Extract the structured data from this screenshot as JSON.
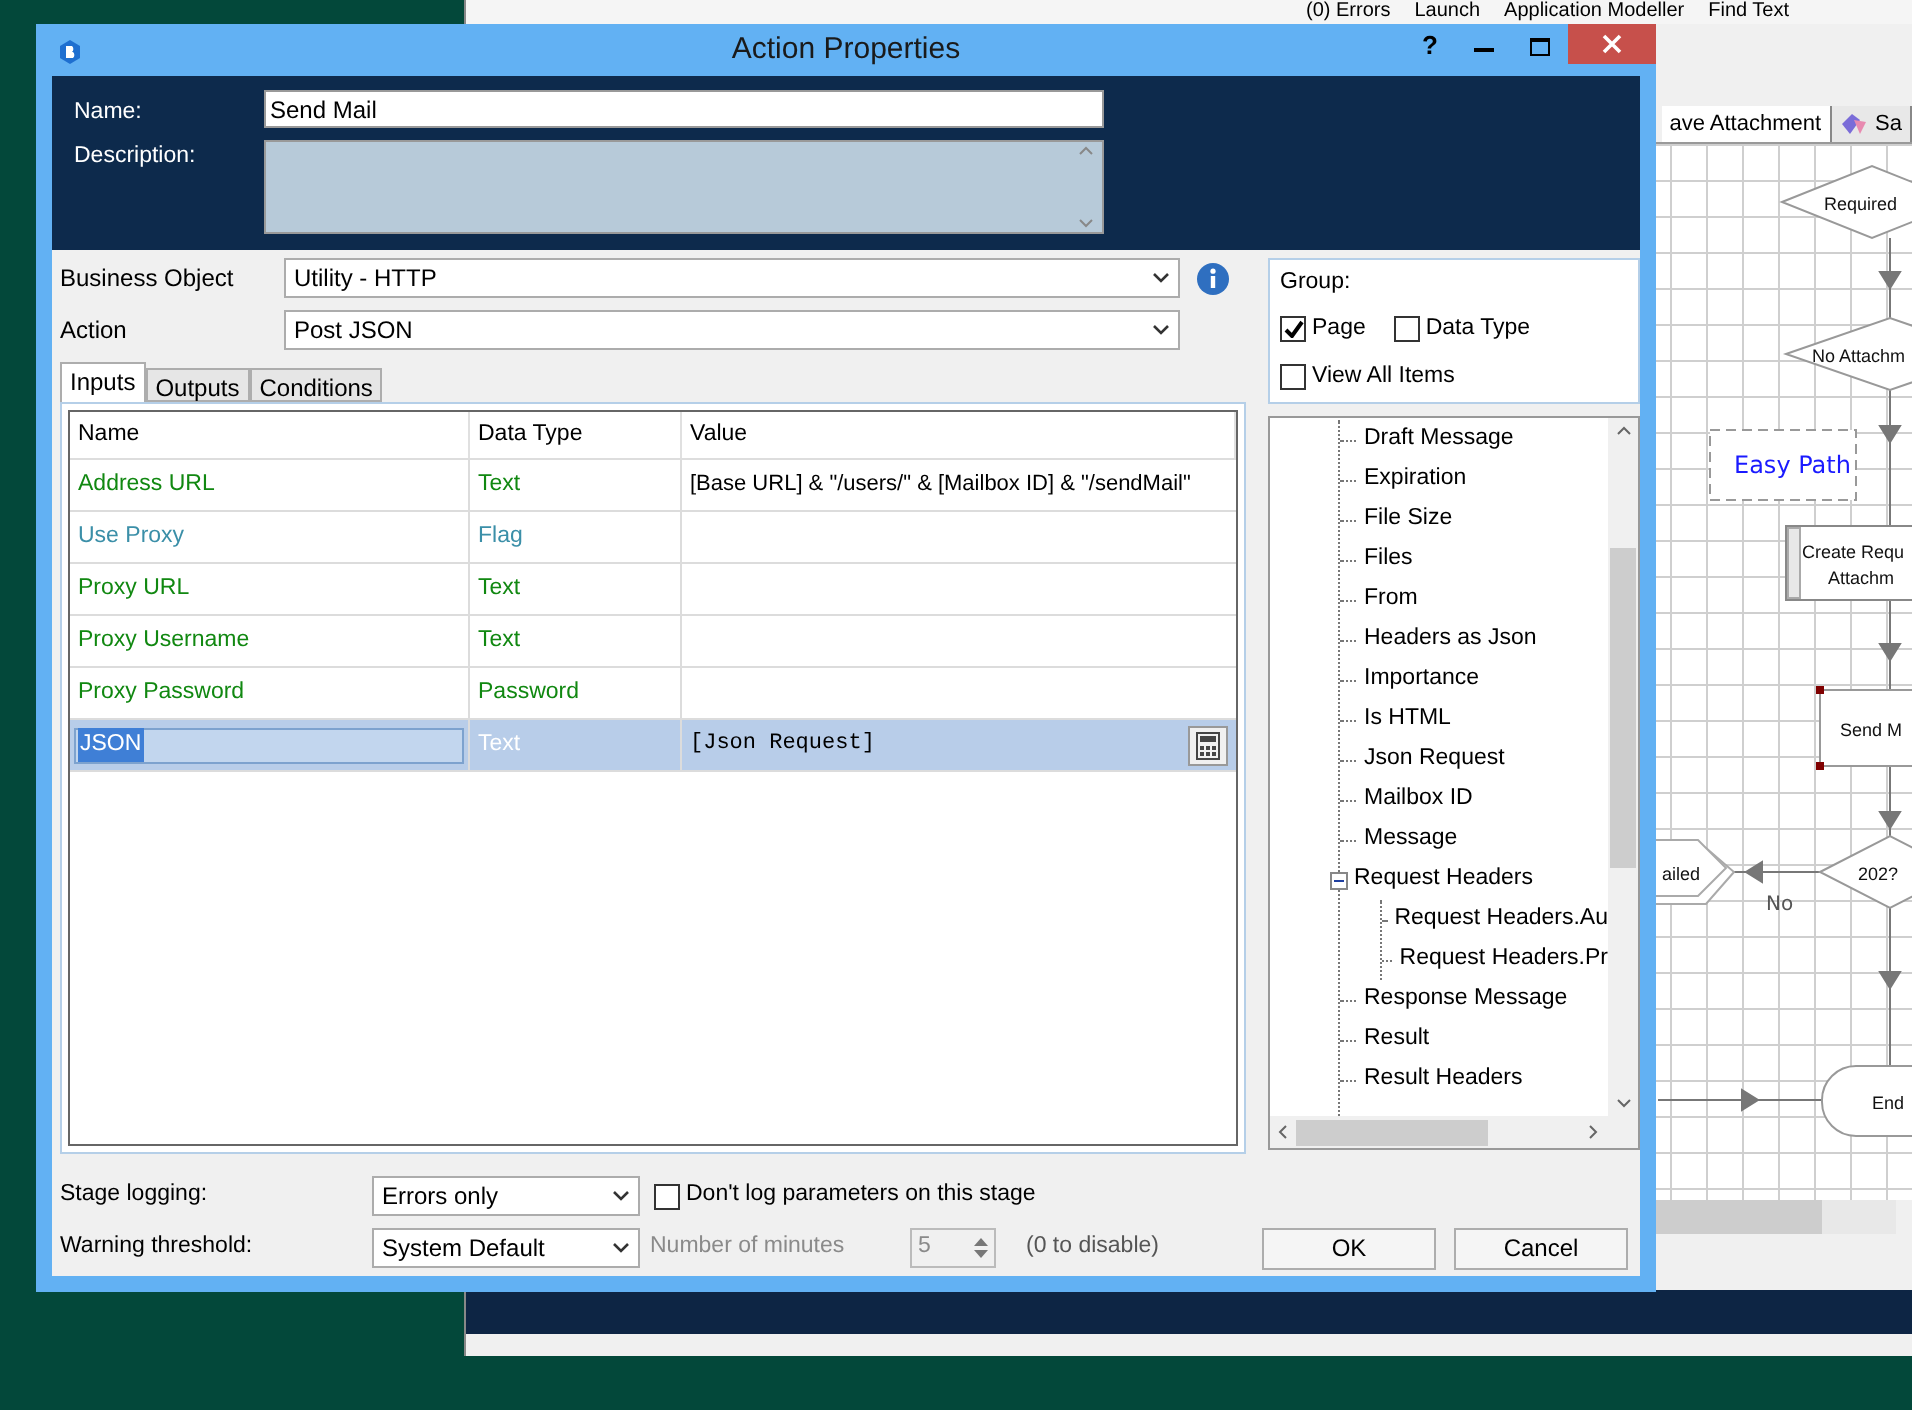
{
  "background_app": {
    "toolbar": [
      {
        "label": "(0) Errors"
      },
      {
        "label": "Launch"
      },
      {
        "label": "Application Modeller"
      },
      {
        "label": "Find Text"
      }
    ],
    "tabs": [
      {
        "label": "ave Attachment",
        "selected": true
      },
      {
        "label": "Sa",
        "selected": false
      }
    ],
    "flowchart": {
      "nodes": [
        {
          "kind": "decision",
          "lines": [
            "Required"
          ]
        },
        {
          "kind": "decision",
          "lines": [
            "No Attachm"
          ]
        },
        {
          "kind": "note",
          "lines": [
            "Easy Path"
          ]
        },
        {
          "kind": "process",
          "lines": [
            "Create Requ",
            "Attachm"
          ]
        },
        {
          "kind": "action",
          "lines": [
            "Send M"
          ],
          "selected": true
        },
        {
          "kind": "decision",
          "lines": [
            "202?"
          ]
        },
        {
          "kind": "exception",
          "lines": [
            "ailed"
          ]
        },
        {
          "kind": "end",
          "lines": [
            "End"
          ]
        }
      ],
      "edge_labels": [
        "No"
      ]
    }
  },
  "dialog": {
    "title": "Action Properties",
    "help": "?",
    "name": {
      "label": "Name:",
      "value": "Send Mail"
    },
    "description": {
      "label": "Description:"
    },
    "business_object": {
      "label": "Business Object",
      "value": "Utility - HTTP"
    },
    "action": {
      "label": "Action",
      "value": "Post JSON"
    },
    "tabs": [
      {
        "label": "Inputs",
        "selected": true
      },
      {
        "label": "Outputs",
        "selected": false
      },
      {
        "label": "Conditions",
        "selected": false
      }
    ],
    "table": {
      "columns": [
        "Name",
        "Data Type",
        "Value"
      ],
      "rows": [
        {
          "name": "Address URL",
          "data_type": "Text",
          "value": "[Base URL] & \"/users/\" & [Mailbox ID] & \"/sendMail\"",
          "color": "#118811",
          "selected": false
        },
        {
          "name": "Use Proxy",
          "data_type": "Flag",
          "color": "#3b8fa8",
          "selected": false
        },
        {
          "name": "Proxy URL",
          "data_type": "Text",
          "color": "#118811",
          "selected": false
        },
        {
          "name": "Proxy Username",
          "data_type": "Text",
          "color": "#118811",
          "selected": false
        },
        {
          "name": "Proxy Password",
          "data_type": "Password",
          "color": "#118811",
          "selected": false
        },
        {
          "name": "JSON",
          "data_type": "Text",
          "value": "[Json Request]",
          "selected": true
        }
      ]
    },
    "group": {
      "label": "Group:",
      "options": [
        {
          "label": "Page",
          "checked": true
        },
        {
          "label": "Data Type",
          "checked": false
        },
        {
          "label": "View All Items",
          "checked": false
        }
      ]
    },
    "tree": [
      {
        "label": "Draft Message"
      },
      {
        "label": "Expiration"
      },
      {
        "label": "File Size"
      },
      {
        "label": "Files"
      },
      {
        "label": "From"
      },
      {
        "label": "Headers as Json"
      },
      {
        "label": "Importance"
      },
      {
        "label": "Is HTML"
      },
      {
        "label": "Json Request"
      },
      {
        "label": "Mailbox ID"
      },
      {
        "label": "Message"
      },
      {
        "label": "Request Headers",
        "expanded": true,
        "children": [
          {
            "label": "Request Headers.Au"
          },
          {
            "label": "Request Headers.Pr"
          }
        ]
      },
      {
        "label": "Response Message"
      },
      {
        "label": "Result"
      },
      {
        "label": "Result Headers"
      }
    ],
    "stage_logging": {
      "label": "Stage logging:",
      "value": "Errors only",
      "checkbox": {
        "label": "Don't log parameters on this stage",
        "checked": false
      }
    },
    "warning": {
      "label": "Warning threshold:",
      "value": "System Default",
      "minutes_label": "Number of minutes",
      "minutes": "5",
      "disabled": true,
      "hint": "(0 to disable)"
    },
    "buttons": [
      "OK",
      "Cancel"
    ]
  }
}
